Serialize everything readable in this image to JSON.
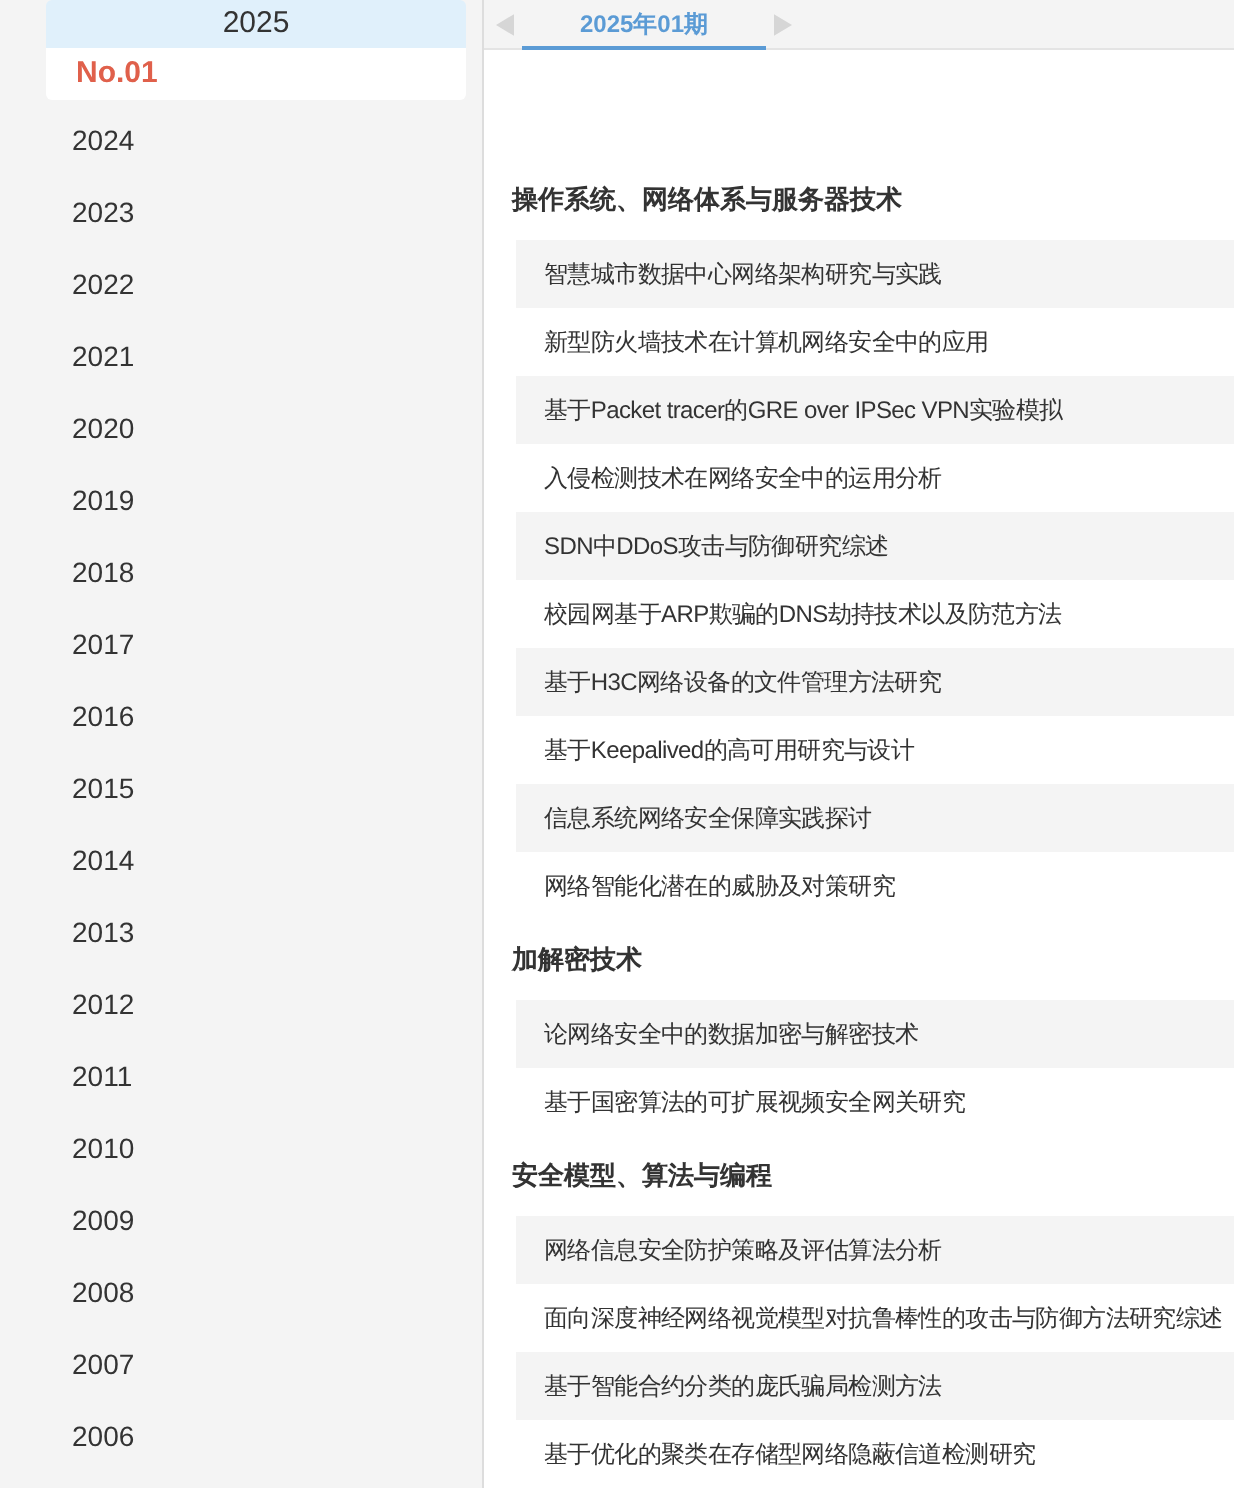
{
  "years": [
    {
      "label": "2025",
      "selected": true,
      "issues": [
        {
          "label": "No.01",
          "selected": true
        }
      ]
    },
    {
      "label": "2024",
      "selected": false
    },
    {
      "label": "2023",
      "selected": false
    },
    {
      "label": "2022",
      "selected": false
    },
    {
      "label": "2021",
      "selected": false
    },
    {
      "label": "2020",
      "selected": false
    },
    {
      "label": "2019",
      "selected": false
    },
    {
      "label": "2018",
      "selected": false
    },
    {
      "label": "2017",
      "selected": false
    },
    {
      "label": "2016",
      "selected": false
    },
    {
      "label": "2015",
      "selected": false
    },
    {
      "label": "2014",
      "selected": false
    },
    {
      "label": "2013",
      "selected": false
    },
    {
      "label": "2012",
      "selected": false
    },
    {
      "label": "2011",
      "selected": false
    },
    {
      "label": "2010",
      "selected": false
    },
    {
      "label": "2009",
      "selected": false
    },
    {
      "label": "2008",
      "selected": false
    },
    {
      "label": "2007",
      "selected": false
    },
    {
      "label": "2006",
      "selected": false
    }
  ],
  "issue_tabs": [
    {
      "label": "2025年01期",
      "selected": true
    }
  ],
  "sections": [
    {
      "title": "操作系统、网络体系与服务器技术",
      "articles": [
        "智慧城市数据中心网络架构研究与实践",
        "新型防火墙技术在计算机网络安全中的应用",
        "基于Packet tracer的GRE over IPSec VPN实验模拟",
        "入侵检测技术在网络安全中的运用分析",
        "SDN中DDoS攻击与防御研究综述",
        "校园网基于ARP欺骗的DNS劫持技术以及防范方法",
        "基于H3C网络设备的文件管理方法研究",
        "基于Keepalived的高可用研究与设计",
        "信息系统网络安全保障实践探讨",
        "网络智能化潜在的威胁及对策研究"
      ]
    },
    {
      "title": "加解密技术",
      "articles": [
        "论网络安全中的数据加密与解密技术",
        "基于国密算法的可扩展视频安全网关研究"
      ]
    },
    {
      "title": "安全模型、算法与编程",
      "articles": [
        "网络信息安全防护策略及评估算法分析",
        "面向深度神经网络视觉模型对抗鲁棒性的攻击与防御方法研究综述",
        "基于智能合约分类的庞氏骗局检测方法",
        "基于优化的聚类在存储型网络隐蔽信道检测研究"
      ]
    }
  ]
}
